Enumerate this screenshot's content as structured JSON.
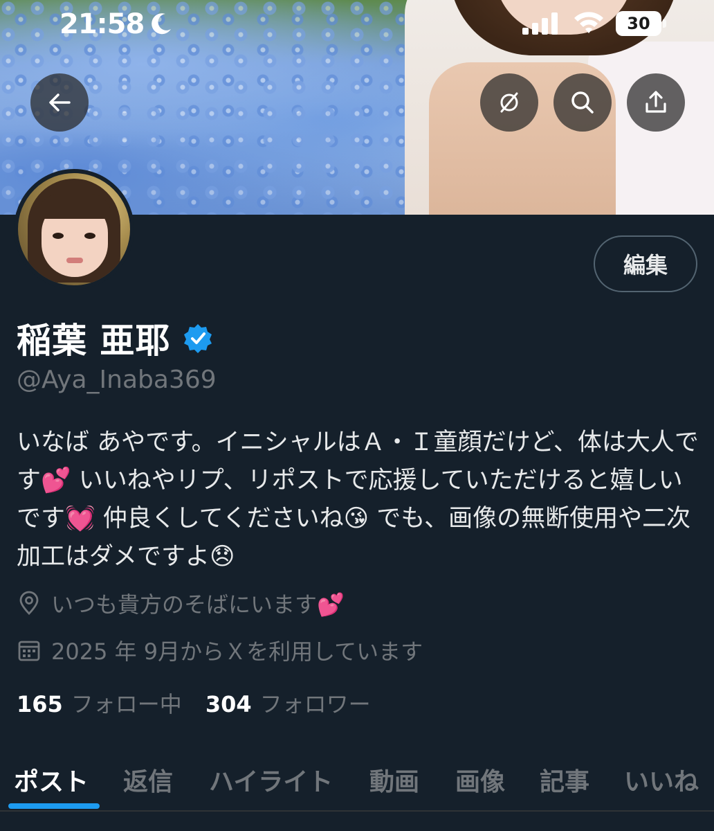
{
  "status_bar": {
    "time": "21:58",
    "battery": "30"
  },
  "profile": {
    "display_name": "稲葉 亜耶",
    "handle": "@Aya_Inaba369",
    "bio": "いなば あやです。イニシャルはＡ・Ｉ童顔だけど、体は大人です💕 いいねやリプ、リポストで応援していただけると嬉しいです💓 仲良くしてくださいね😘 でも、画像の無断使用や二次加工はダメですよ😞",
    "location": "いつも貴方のそばにいます💕",
    "joined": "2025 年 9月からＸを利用しています",
    "following_count": "165",
    "following_label": "フォロー中",
    "followers_count": "304",
    "followers_label": "フォロワー",
    "verified_color": "#1d9bf0"
  },
  "buttons": {
    "edit_label": "編集"
  },
  "icons": {
    "back": "arrow-left-icon",
    "unsync": "no-sync-icon",
    "search": "search-icon",
    "share": "share-icon",
    "location": "location-pin-icon",
    "calendar": "calendar-icon"
  },
  "tabs": [
    {
      "label": "ポスト",
      "active": true
    },
    {
      "label": "返信"
    },
    {
      "label": "ハイライト"
    },
    {
      "label": "動画"
    },
    {
      "label": "画像"
    },
    {
      "label": "記事"
    },
    {
      "label": "いいね"
    }
  ],
  "colors": {
    "background": "#15202b",
    "accent": "#1d9bf0",
    "muted": "#71767b"
  }
}
